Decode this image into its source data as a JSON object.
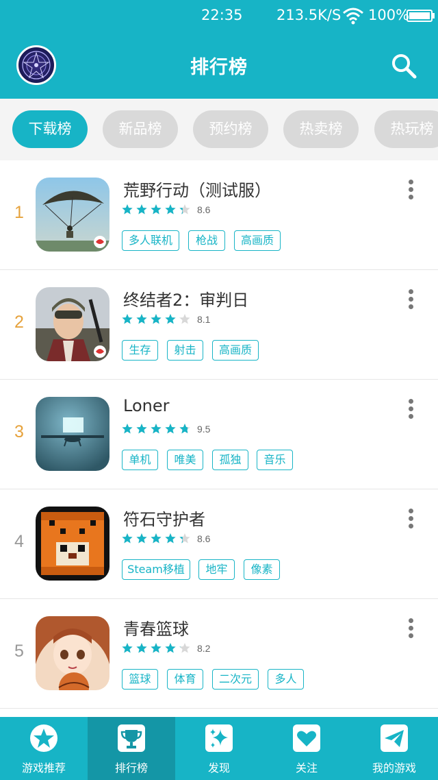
{
  "status_bar": {
    "time": "22:35",
    "speed": "213.5K/S",
    "battery": "100%"
  },
  "header": {
    "title": "排行榜"
  },
  "tabs": [
    {
      "label": "下载榜",
      "active": true
    },
    {
      "label": "新品榜",
      "active": false
    },
    {
      "label": "预约榜",
      "active": false
    },
    {
      "label": "热卖榜",
      "active": false
    },
    {
      "label": "热玩榜",
      "active": false
    }
  ],
  "games": [
    {
      "rank": "1",
      "name": "荒野行动（测试服）",
      "rating": 8.6,
      "rating_text": "8.6",
      "tags": [
        "多人联机",
        "枪战",
        "高画质"
      ]
    },
    {
      "rank": "2",
      "name": "终结者2：审判日",
      "rating": 8.1,
      "rating_text": "8.1",
      "tags": [
        "生存",
        "射击",
        "高画质"
      ]
    },
    {
      "rank": "3",
      "name": "Loner",
      "rating": 9.5,
      "rating_text": "9.5",
      "tags": [
        "单机",
        "唯美",
        "孤独",
        "音乐"
      ]
    },
    {
      "rank": "4",
      "name": "符石守护者",
      "rating": 8.6,
      "rating_text": "8.6",
      "tags": [
        "Steam移植",
        "地牢",
        "像素"
      ]
    },
    {
      "rank": "5",
      "name": "青春篮球",
      "rating": 8.2,
      "rating_text": "8.2",
      "tags": [
        "篮球",
        "体育",
        "二次元",
        "多人"
      ]
    }
  ],
  "bottom_nav": [
    {
      "label": "游戏推荐",
      "icon": "star-icon",
      "active": false
    },
    {
      "label": "排行榜",
      "icon": "trophy-icon",
      "active": true
    },
    {
      "label": "发现",
      "icon": "sparkle-icon",
      "active": false
    },
    {
      "label": "关注",
      "icon": "heart-icon",
      "active": false
    },
    {
      "label": "我的游戏",
      "icon": "paper-plane-icon",
      "active": false
    }
  ],
  "colors": {
    "accent": "#17b4c6",
    "accent_dark": "#1496a6",
    "rank_top": "#e6a23c",
    "star": "#17b4c6"
  }
}
